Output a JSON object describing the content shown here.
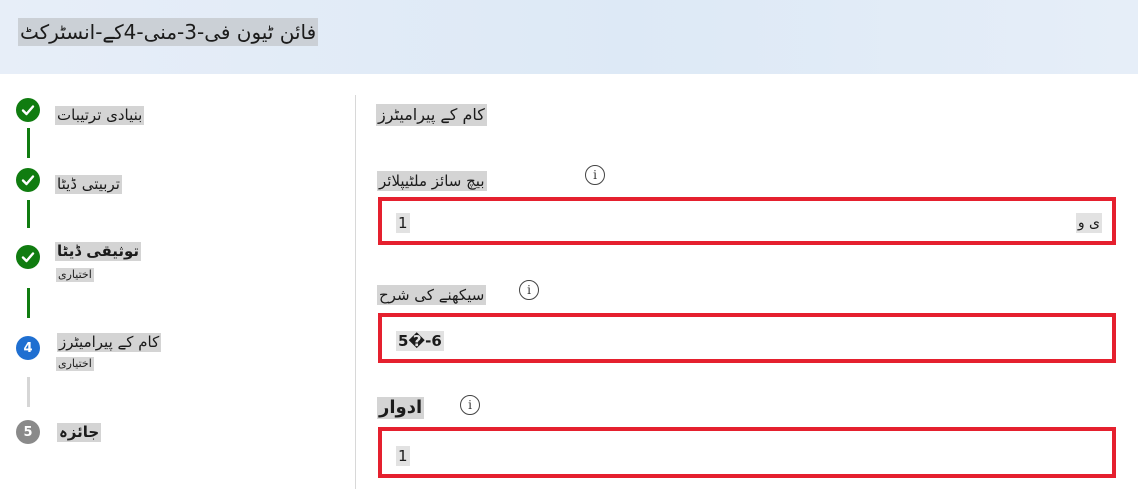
{
  "header": {
    "title": "فائن ٹیون فی-3-منی-4کے-انسٹرکٹ"
  },
  "stepper": {
    "steps": [
      {
        "number": "1",
        "label": "بنیادی ترتیبات",
        "sub": "",
        "state": "done"
      },
      {
        "number": "2",
        "label": "تربیتی ڈیٹا",
        "sub": "",
        "state": "done"
      },
      {
        "number": "3",
        "label": "توثیقی ڈیٹا",
        "sub": "اختیاری",
        "state": "done"
      },
      {
        "number": "4",
        "label": "کام کے پیرامیٹرز",
        "sub": "اختیاری",
        "state": "current"
      },
      {
        "number": "5",
        "label": "جائزہ",
        "sub": "",
        "state": "pending"
      }
    ]
  },
  "main": {
    "section_title": "کام کے پیرامیٹرز",
    "fields": [
      {
        "label": "بیچ سائز ملٹیپلائر",
        "value": "1",
        "suffix": "ی و"
      },
      {
        "label": "سیکھنے کی شرح",
        "value": "5�-6",
        "suffix": ""
      },
      {
        "label": "ادوار",
        "value": "1",
        "suffix": ""
      }
    ]
  },
  "colors": {
    "done": "#107c10",
    "current": "#1f6fd1",
    "pending": "#8a8a8a",
    "highlight_border": "#e5202e"
  },
  "icons": {
    "check": "check-icon",
    "info": "info-icon"
  }
}
